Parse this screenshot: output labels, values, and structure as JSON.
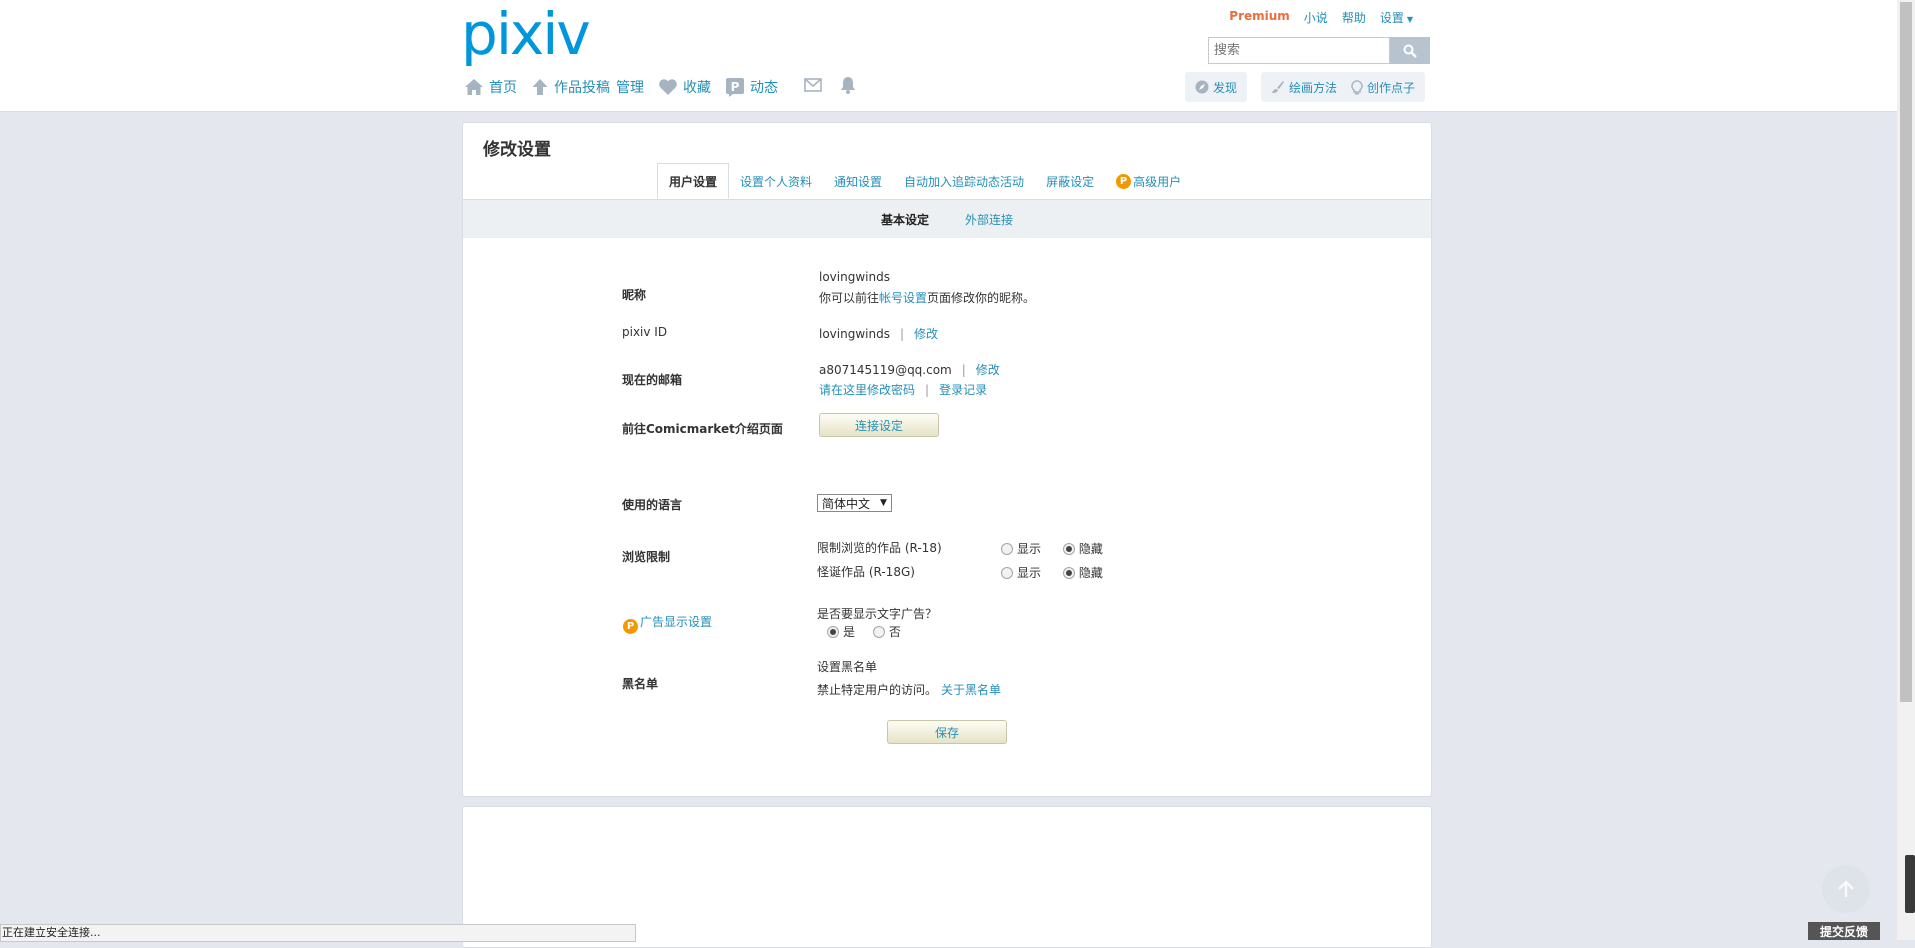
{
  "header": {
    "logo": "pixiv",
    "top_links": {
      "premium": "Premium",
      "novel": "小说",
      "help": "帮助",
      "settings": "设置"
    },
    "search": {
      "placeholder": "搜索"
    },
    "nav": {
      "home": "首页",
      "upload": "作品投稿",
      "manage": "管理",
      "bookmarks": "收藏",
      "activity": "动态"
    },
    "nav_right": {
      "discover": "发现",
      "how_to_draw": "绘画方法",
      "ideas": "创作点子"
    }
  },
  "page": {
    "title": "修改设置",
    "tabs": [
      "用户设置",
      "设置个人资料",
      "通知设置",
      "自动加入追踪动态活动",
      "屏蔽设定",
      "高级用户"
    ],
    "active_tab": "用户设置",
    "subtabs": [
      "基本设定",
      "外部连接"
    ],
    "active_subtab": "基本设定"
  },
  "form": {
    "nickname": {
      "label": "昵称",
      "value": "lovingwinds",
      "hint_prefix": "你可以前往",
      "hint_link": "帐号设置",
      "hint_suffix": "页面修改你的昵称。"
    },
    "pixiv_id": {
      "label": "pixiv ID",
      "value": "lovingwinds",
      "edit": "修改"
    },
    "email": {
      "label": "现在的邮箱",
      "value": "a807145119@qq.com",
      "edit": "修改",
      "change_password": "请在这里修改密码",
      "login_history": "登录记录"
    },
    "comicmarket": {
      "label": "前往Comicmarket介绍页面",
      "button": "连接设定"
    },
    "language": {
      "label": "使用的语言",
      "selected": "简体中文"
    },
    "restriction": {
      "label": "浏览限制",
      "items": [
        {
          "name": "限制浏览的作品 (R-18)",
          "show": "显示",
          "hide": "隐藏",
          "selected": "hide"
        },
        {
          "name": "怪诞作品 (R-18G)",
          "show": "显示",
          "hide": "隐藏",
          "selected": "hide"
        }
      ]
    },
    "ads": {
      "label": "广告显示设置",
      "question": "是否要显示文字广告？",
      "yes": "是",
      "no": "否",
      "selected": "yes"
    },
    "blacklist": {
      "label": "黑名单",
      "set_link": "设置黑名单",
      "desc": "禁止特定用户的访问。",
      "about_link": "关于黑名单"
    },
    "save_button": "保存"
  },
  "browser": {
    "status": "正在建立安全连接...",
    "feedback": "提交反馈"
  },
  "colors": {
    "brand": "#0096db",
    "link": "#258fb8",
    "premium": "#ec6d3a",
    "premium_badge": "#f39800",
    "page_bg": "#e4e7ee"
  }
}
